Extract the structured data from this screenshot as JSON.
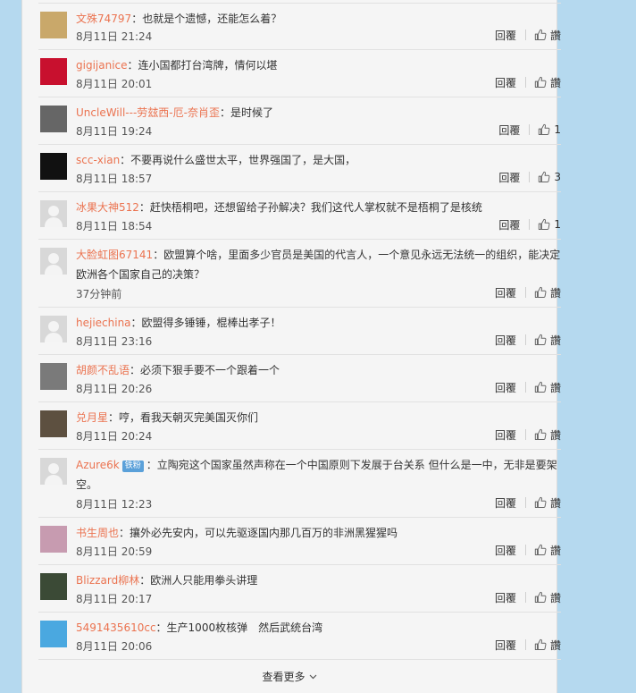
{
  "comments": [
    {
      "user": "文殊74797",
      "text": "：也就是个遗憾，还能怎么着？",
      "time": "8月11日 21:24",
      "reply": "回覆",
      "like": "讚",
      "avatar": "#c9a86a"
    },
    {
      "user": "gigijanice",
      "text": "：连小国都打台湾牌，情何以堪",
      "time": "8月11日 20:01",
      "reply": "回覆",
      "like": "讚",
      "avatar": "#c8102e"
    },
    {
      "user": "UncleWill---劳玆西-厄-奈肖歪",
      "text": "：是时候了",
      "time": "8月11日 19:24",
      "reply": "回覆",
      "like": "1",
      "avatar": "#666666"
    },
    {
      "user": "scc-xian",
      "text": "：不要再说什么盛世太平，世界强国了，是大国，",
      "time": "8月11日 18:57",
      "reply": "回覆",
      "like": "3",
      "avatar": "#111111"
    },
    {
      "user": "冰果大神512",
      "text": "：赶快梧桐吧，还想留给子孙解决？我们这代人掌权就不是梧桐了是核统",
      "time": "8月11日 18:54",
      "reply": "回覆",
      "like": "1",
      "avatar": "default"
    },
    {
      "user": "大脸虹图67141",
      "text": "：欧盟算个啥，里面多少官员是美国的代言人，一个意见永远无法统一的组织，能决定欧洲各个国家自己的决策？",
      "time": "37分钟前",
      "reply": "回覆",
      "like": "讚",
      "avatar": "default"
    },
    {
      "user": "hejiechina",
      "text": "：欧盟得多锤锤，棍棒出孝子！",
      "time": "8月11日 23:16",
      "reply": "回覆",
      "like": "讚",
      "avatar": "default"
    },
    {
      "user": "胡颜不乱语",
      "text": "：必须下狠手要不一个跟着一个",
      "time": "8月11日 20:26",
      "reply": "回覆",
      "like": "讚",
      "avatar": "#7a7a7a"
    },
    {
      "user": "兑月星",
      "text": "：哼，看我天朝灭完美国灭你们",
      "time": "8月11日 20:24",
      "reply": "回覆",
      "like": "讚",
      "avatar": "#5d5040"
    },
    {
      "user": "Azure6k",
      "badge": "铁粉",
      "text": "：立陶宛这个国家虽然声称在一个中国原则下发展于台关系 但什么是一中，无非是要架空。",
      "time": "8月11日 12:23",
      "reply": "回覆",
      "like": "讚",
      "avatar": "default"
    },
    {
      "user": "书生周也",
      "text": "：攘外必先安内，可以先驱逐国内那几百万的非洲黑猩猩吗",
      "time": "8月11日 20:59",
      "reply": "回覆",
      "like": "讚",
      "avatar": "#c79bb0"
    },
    {
      "user": "Blizzard柳林",
      "text": "：欧洲人只能用拳头讲理",
      "time": "8月11日 20:17",
      "reply": "回覆",
      "like": "讚",
      "avatar": "#3b4a36"
    },
    {
      "user": "5491435610cc",
      "text": "：生产1000枚核弹　然后武统台湾",
      "time": "8月11日 20:06",
      "reply": "回覆",
      "like": "讚",
      "avatar": "#4aa8e0"
    }
  ],
  "more": {
    "label": "查看更多"
  }
}
